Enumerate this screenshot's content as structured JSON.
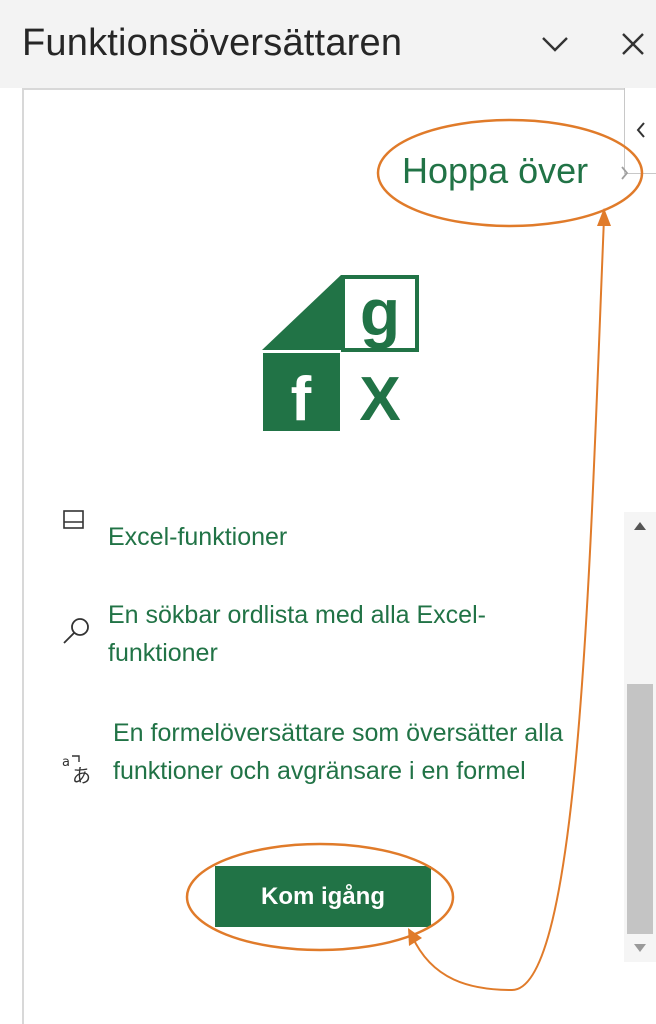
{
  "pane": {
    "title": "Funktionsöversättaren",
    "options_icon": "chevron-down-icon",
    "close_icon": "close-icon",
    "collapse_icon": "chevron-left-icon"
  },
  "onboarding": {
    "skip_label": "Hoppa över",
    "logo_letters": {
      "top": "g",
      "bottom_left": "f",
      "bottom_right": "X"
    },
    "features": [
      {
        "icon": "list-icon",
        "text": "Excel-funktioner"
      },
      {
        "icon": "search-icon",
        "text": "En sökbar ordlista med alla Excel-funktioner"
      },
      {
        "icon": "translate-icon",
        "text": "En formelöversättare som översätter alla funktioner och avgränsare i en formel"
      }
    ],
    "start_label": "Kom igång"
  },
  "colors": {
    "accent": "#217346",
    "annotation": "#e07b2a",
    "header_bg": "#f3f3f3"
  }
}
